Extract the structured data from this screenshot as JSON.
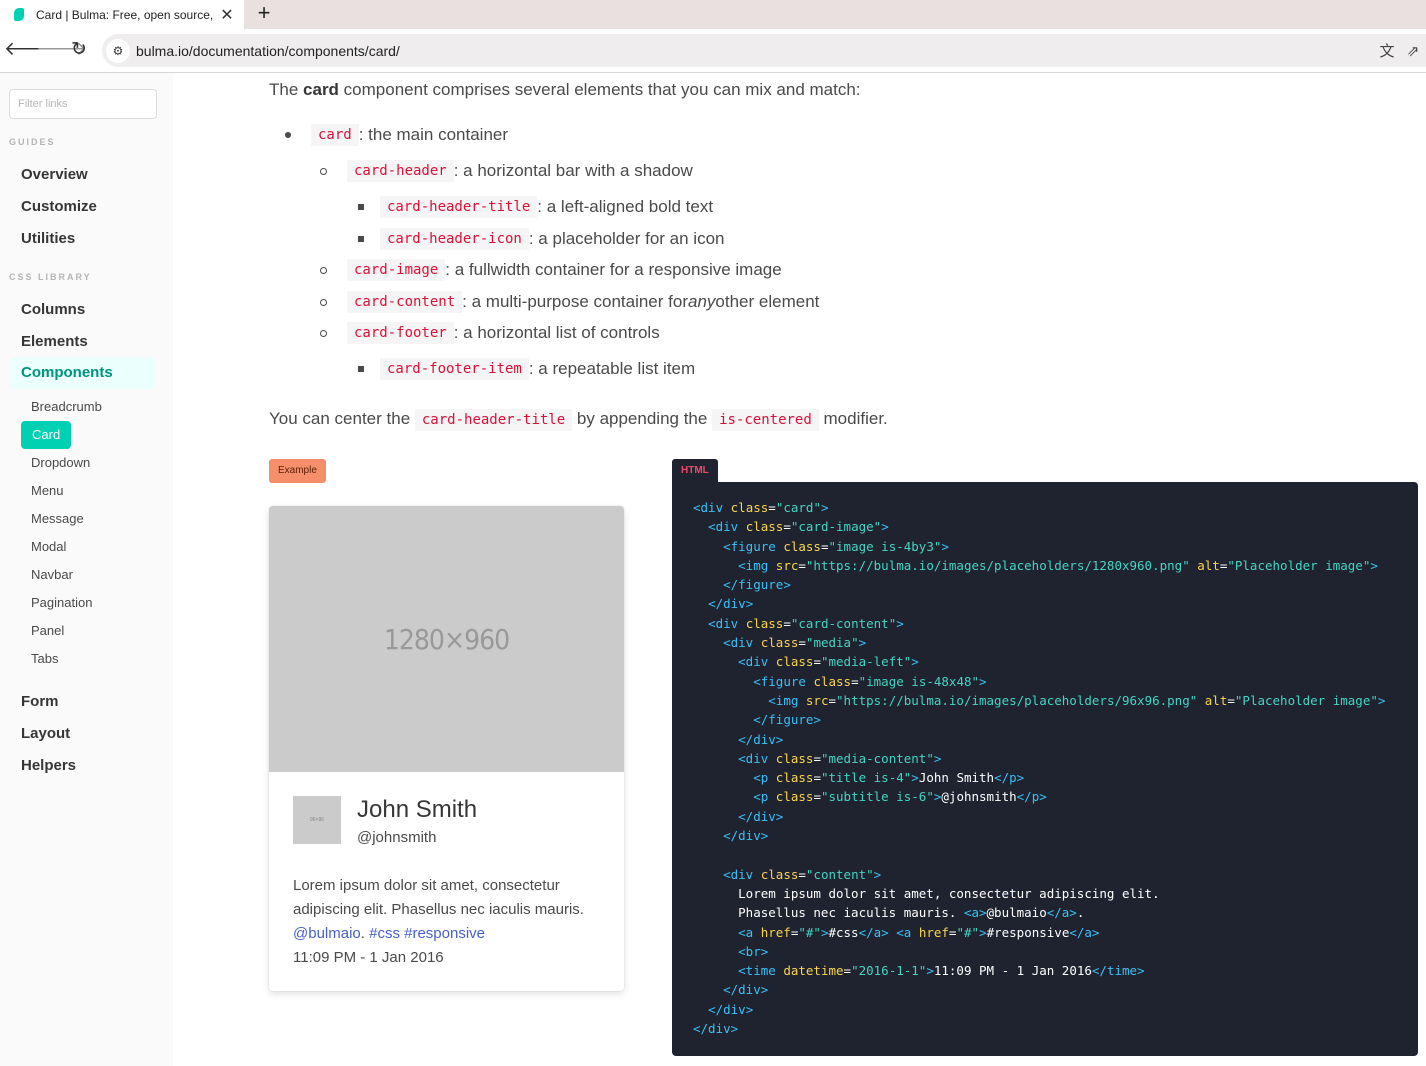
{
  "browser": {
    "tab_title": "Card | Bulma: Free, open source,",
    "close_glyph": "✕",
    "new_tab_glyph": "+",
    "url": "bulma.io/documentation/components/card/"
  },
  "sidebar": {
    "filter_placeholder": "Filter links",
    "guides_label": "GUIDES",
    "guides": [
      "Overview",
      "Customize",
      "Utilities"
    ],
    "css_label": "CSS LIBRARY",
    "library": [
      "Columns",
      "Elements",
      "Components"
    ],
    "components": [
      "Breadcrumb",
      "Card",
      "Dropdown",
      "Menu",
      "Message",
      "Modal",
      "Navbar",
      "Pagination",
      "Panel",
      "Tabs"
    ],
    "more": [
      "Form",
      "Layout",
      "Helpers"
    ]
  },
  "intro": {
    "before": "The ",
    "bold": "card",
    "after": " component comprises several elements that you can mix and match:"
  },
  "list": [
    {
      "code": "card",
      "text": ": the main container"
    },
    {
      "code": "card-header",
      "text": ": a horizontal bar with a shadow"
    },
    {
      "code": "card-header-title",
      "text": ": a left-aligned bold text"
    },
    {
      "code": "card-header-icon",
      "text": ": a placeholder for an icon"
    },
    {
      "code": "card-image",
      "text": ": a fullwidth container for a responsive image"
    },
    {
      "code": "card-content",
      "text_before": ": a multi-purpose container for ",
      "em": "any",
      "text_after": " other element"
    },
    {
      "code": "card-footer",
      "text": ": a horizontal list of controls"
    },
    {
      "code": "card-footer-item",
      "text": ": a repeatable list item"
    }
  ],
  "center_note": {
    "before": "You can center the ",
    "code1": "card-header-title",
    "middle": " by appending the ",
    "code2": "is-centered",
    "after": " modifier."
  },
  "example_tag": "Example",
  "html_tag": "HTML",
  "card": {
    "image_placeholder": "1280×960",
    "avatar_placeholder": "96×96",
    "name": "John Smith",
    "handle": "@johnsmith",
    "text": "Lorem ipsum dolor sit amet, consectetur adipiscing elit. Phasellus nec iaculis mauris.",
    "link_mention": "@bulmaio",
    "link_css": "#css",
    "link_responsive": "#responsive",
    "time": "11:09 PM - 1 Jan 2016"
  },
  "code_lines": [
    [
      [
        "t",
        "<div "
      ],
      [
        "a",
        "class"
      ],
      [
        "p",
        "="
      ],
      [
        "s",
        "\"card\""
      ],
      [
        "t",
        ">"
      ]
    ],
    [
      [
        "p",
        "  "
      ],
      [
        "t",
        "<div "
      ],
      [
        "a",
        "class"
      ],
      [
        "p",
        "="
      ],
      [
        "s",
        "\"card-image\""
      ],
      [
        "t",
        ">"
      ]
    ],
    [
      [
        "p",
        "    "
      ],
      [
        "t",
        "<figure "
      ],
      [
        "a",
        "class"
      ],
      [
        "p",
        "="
      ],
      [
        "s",
        "\"image is-4by3\""
      ],
      [
        "t",
        ">"
      ]
    ],
    [
      [
        "p",
        "      "
      ],
      [
        "t",
        "<img "
      ],
      [
        "a",
        "src"
      ],
      [
        "p",
        "="
      ],
      [
        "s",
        "\"https://bulma.io/images/placeholders/1280x960.png\""
      ],
      [
        "p",
        " "
      ],
      [
        "a",
        "alt"
      ],
      [
        "p",
        "="
      ],
      [
        "s",
        "\"Placeholder image\""
      ],
      [
        "t",
        ">"
      ]
    ],
    [
      [
        "p",
        "    "
      ],
      [
        "t",
        "</figure>"
      ]
    ],
    [
      [
        "p",
        "  "
      ],
      [
        "t",
        "</div>"
      ]
    ],
    [
      [
        "p",
        "  "
      ],
      [
        "t",
        "<div "
      ],
      [
        "a",
        "class"
      ],
      [
        "p",
        "="
      ],
      [
        "s",
        "\"card-content\""
      ],
      [
        "t",
        ">"
      ]
    ],
    [
      [
        "p",
        "    "
      ],
      [
        "t",
        "<div "
      ],
      [
        "a",
        "class"
      ],
      [
        "p",
        "="
      ],
      [
        "s",
        "\"media\""
      ],
      [
        "t",
        ">"
      ]
    ],
    [
      [
        "p",
        "      "
      ],
      [
        "t",
        "<div "
      ],
      [
        "a",
        "class"
      ],
      [
        "p",
        "="
      ],
      [
        "s",
        "\"media-left\""
      ],
      [
        "t",
        ">"
      ]
    ],
    [
      [
        "p",
        "        "
      ],
      [
        "t",
        "<figure "
      ],
      [
        "a",
        "class"
      ],
      [
        "p",
        "="
      ],
      [
        "s",
        "\"image is-48x48\""
      ],
      [
        "t",
        ">"
      ]
    ],
    [
      [
        "p",
        "          "
      ],
      [
        "t",
        "<img "
      ],
      [
        "a",
        "src"
      ],
      [
        "p",
        "="
      ],
      [
        "s",
        "\"https://bulma.io/images/placeholders/96x96.png\""
      ],
      [
        "p",
        " "
      ],
      [
        "a",
        "alt"
      ],
      [
        "p",
        "="
      ],
      [
        "s",
        "\"Placeholder image\""
      ],
      [
        "t",
        ">"
      ]
    ],
    [
      [
        "p",
        "        "
      ],
      [
        "t",
        "</figure>"
      ]
    ],
    [
      [
        "p",
        "      "
      ],
      [
        "t",
        "</div>"
      ]
    ],
    [
      [
        "p",
        "      "
      ],
      [
        "t",
        "<div "
      ],
      [
        "a",
        "class"
      ],
      [
        "p",
        "="
      ],
      [
        "s",
        "\"media-content\""
      ],
      [
        "t",
        ">"
      ]
    ],
    [
      [
        "p",
        "        "
      ],
      [
        "t",
        "<p "
      ],
      [
        "a",
        "class"
      ],
      [
        "p",
        "="
      ],
      [
        "s",
        "\"title is-4\""
      ],
      [
        "t",
        ">"
      ],
      [
        "p",
        "John Smith"
      ],
      [
        "t",
        "</p>"
      ]
    ],
    [
      [
        "p",
        "        "
      ],
      [
        "t",
        "<p "
      ],
      [
        "a",
        "class"
      ],
      [
        "p",
        "="
      ],
      [
        "s",
        "\"subtitle is-6\""
      ],
      [
        "t",
        ">"
      ],
      [
        "p",
        "@johnsmith"
      ],
      [
        "t",
        "</p>"
      ]
    ],
    [
      [
        "p",
        "      "
      ],
      [
        "t",
        "</div>"
      ]
    ],
    [
      [
        "p",
        "    "
      ],
      [
        "t",
        "</div>"
      ]
    ],
    [
      [
        "p",
        ""
      ]
    ],
    [
      [
        "p",
        "    "
      ],
      [
        "t",
        "<div "
      ],
      [
        "a",
        "class"
      ],
      [
        "p",
        "="
      ],
      [
        "s",
        "\"content\""
      ],
      [
        "t",
        ">"
      ]
    ],
    [
      [
        "p",
        "      Lorem ipsum dolor sit amet, consectetur adipiscing elit."
      ]
    ],
    [
      [
        "p",
        "      Phasellus nec iaculis mauris. "
      ],
      [
        "t",
        "<a>"
      ],
      [
        "p",
        "@bulmaio"
      ],
      [
        "t",
        "</a>"
      ],
      [
        "p",
        "."
      ]
    ],
    [
      [
        "p",
        "      "
      ],
      [
        "t",
        "<a "
      ],
      [
        "a",
        "href"
      ],
      [
        "p",
        "="
      ],
      [
        "s",
        "\"#\""
      ],
      [
        "t",
        ">"
      ],
      [
        "p",
        "#css"
      ],
      [
        "t",
        "</a>"
      ],
      [
        "p",
        " "
      ],
      [
        "t",
        "<a "
      ],
      [
        "a",
        "href"
      ],
      [
        "p",
        "="
      ],
      [
        "s",
        "\"#\""
      ],
      [
        "t",
        ">"
      ],
      [
        "p",
        "#responsive"
      ],
      [
        "t",
        "</a>"
      ]
    ],
    [
      [
        "p",
        "      "
      ],
      [
        "t",
        "<br>"
      ]
    ],
    [
      [
        "p",
        "      "
      ],
      [
        "t",
        "<time "
      ],
      [
        "a",
        "datetime"
      ],
      [
        "p",
        "="
      ],
      [
        "s",
        "\"2016-1-1\""
      ],
      [
        "t",
        ">"
      ],
      [
        "p",
        "11:09 PM - 1 Jan 2016"
      ],
      [
        "t",
        "</time>"
      ]
    ],
    [
      [
        "p",
        "    "
      ],
      [
        "t",
        "</div>"
      ]
    ],
    [
      [
        "p",
        "  "
      ],
      [
        "t",
        "</div>"
      ]
    ],
    [
      [
        "t",
        "</div>"
      ]
    ]
  ]
}
